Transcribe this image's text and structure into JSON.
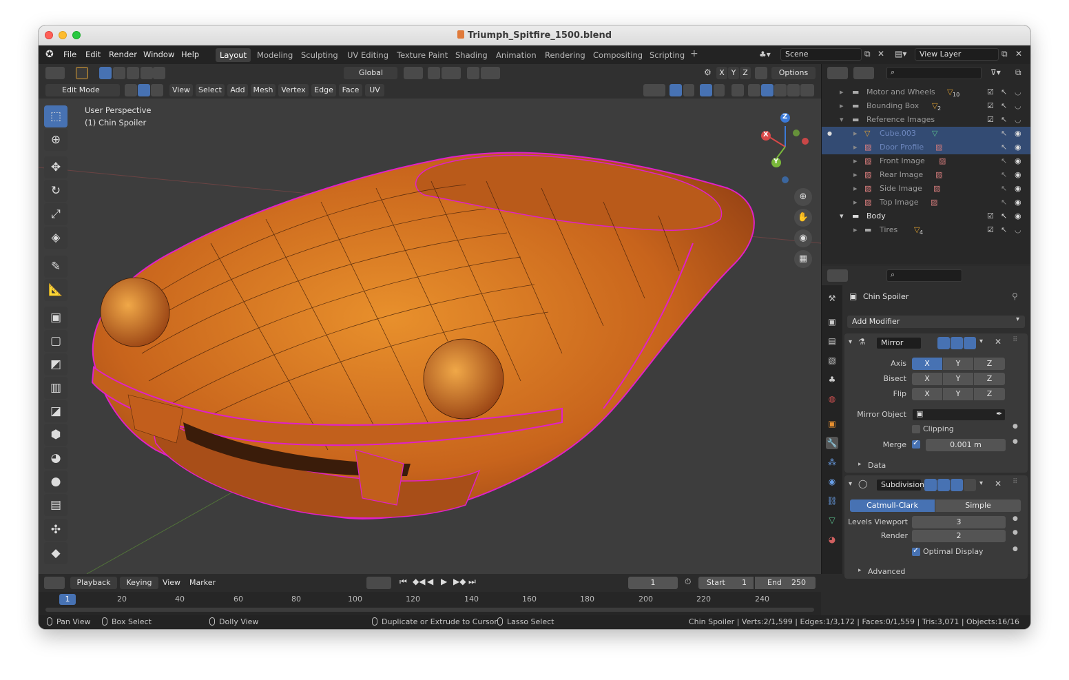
{
  "window": {
    "title": "Triumph_Spitfire_1500.blend"
  },
  "menu": [
    "File",
    "Edit",
    "Render",
    "Window",
    "Help"
  ],
  "workspaces": [
    "Layout",
    "Modeling",
    "Sculpting",
    "UV Editing",
    "Texture Paint",
    "Shading",
    "Animation",
    "Rendering",
    "Compositing",
    "Scripting"
  ],
  "scene": {
    "name": "Scene",
    "view_layer": "View Layer"
  },
  "viewport_header": {
    "transform_orientation": "Global",
    "options_label": "Options",
    "mode": "Edit Mode",
    "menus": [
      "View",
      "Select",
      "Add",
      "Mesh",
      "Vertex",
      "Edge",
      "Face",
      "UV"
    ],
    "axes": [
      "X",
      "Y",
      "Z"
    ]
  },
  "viewport": {
    "perspective": "User Perspective",
    "object": "(1) Chin Spoiler",
    "gizmo_axes": [
      "X",
      "Y",
      "Z"
    ]
  },
  "outliner": {
    "rows": [
      {
        "name": "Motor and Wheels",
        "badge": "10"
      },
      {
        "name": "Bounding Box",
        "badge": "2"
      },
      {
        "name": "Reference Images",
        "badge": ""
      },
      {
        "name": "Cube.003",
        "badge": ""
      },
      {
        "name": "Door Profile",
        "badge": ""
      },
      {
        "name": "Front Image",
        "badge": ""
      },
      {
        "name": "Rear Image",
        "badge": ""
      },
      {
        "name": "Side Image",
        "badge": ""
      },
      {
        "name": "Top Image",
        "badge": ""
      },
      {
        "name": "Body",
        "badge": ""
      },
      {
        "name": "Tires",
        "badge": "4"
      }
    ]
  },
  "properties": {
    "object_name": "Chin Spoiler",
    "add_modifier": "Add Modifier",
    "mirror": {
      "name": "Mirror",
      "axis_label": "Axis",
      "bisect_label": "Bisect",
      "flip_label": "Flip",
      "mirror_object_label": "Mirror Object",
      "clipping_label": "Clipping",
      "merge_label": "Merge",
      "merge_value": "0.001 m",
      "data_label": "Data"
    },
    "subdivision": {
      "name": "Subdivision",
      "method_a": "Catmull-Clark",
      "method_b": "Simple",
      "levels_label": "Levels Viewport",
      "levels_value": "3",
      "render_label": "Render",
      "render_value": "2",
      "optimal_label": "Optimal Display",
      "advanced_label": "Advanced"
    }
  },
  "timeline": {
    "menus": [
      "Playback",
      "Keying",
      "View",
      "Marker"
    ],
    "current_frame": "1",
    "start_label": "Start",
    "start_value": "1",
    "end_label": "End",
    "end_value": "250",
    "ticks": [
      "1",
      "20",
      "40",
      "60",
      "80",
      "100",
      "120",
      "140",
      "160",
      "180",
      "200",
      "220",
      "240"
    ]
  },
  "statusbar": {
    "pan": "Pan View",
    "box": "Box Select",
    "dolly": "Dolly View",
    "duplicate": "Duplicate or Extrude to Cursor",
    "lasso": "Lasso Select",
    "stats": "Chin Spoiler | Verts:2/1,599 | Edges:1/3,172 | Faces:0/1,559 | Tris:3,071 | Objects:16/16"
  },
  "colors": {
    "accent": "#4772b3",
    "selection_outline": "#e020c8",
    "car_body": "#c8641c"
  }
}
